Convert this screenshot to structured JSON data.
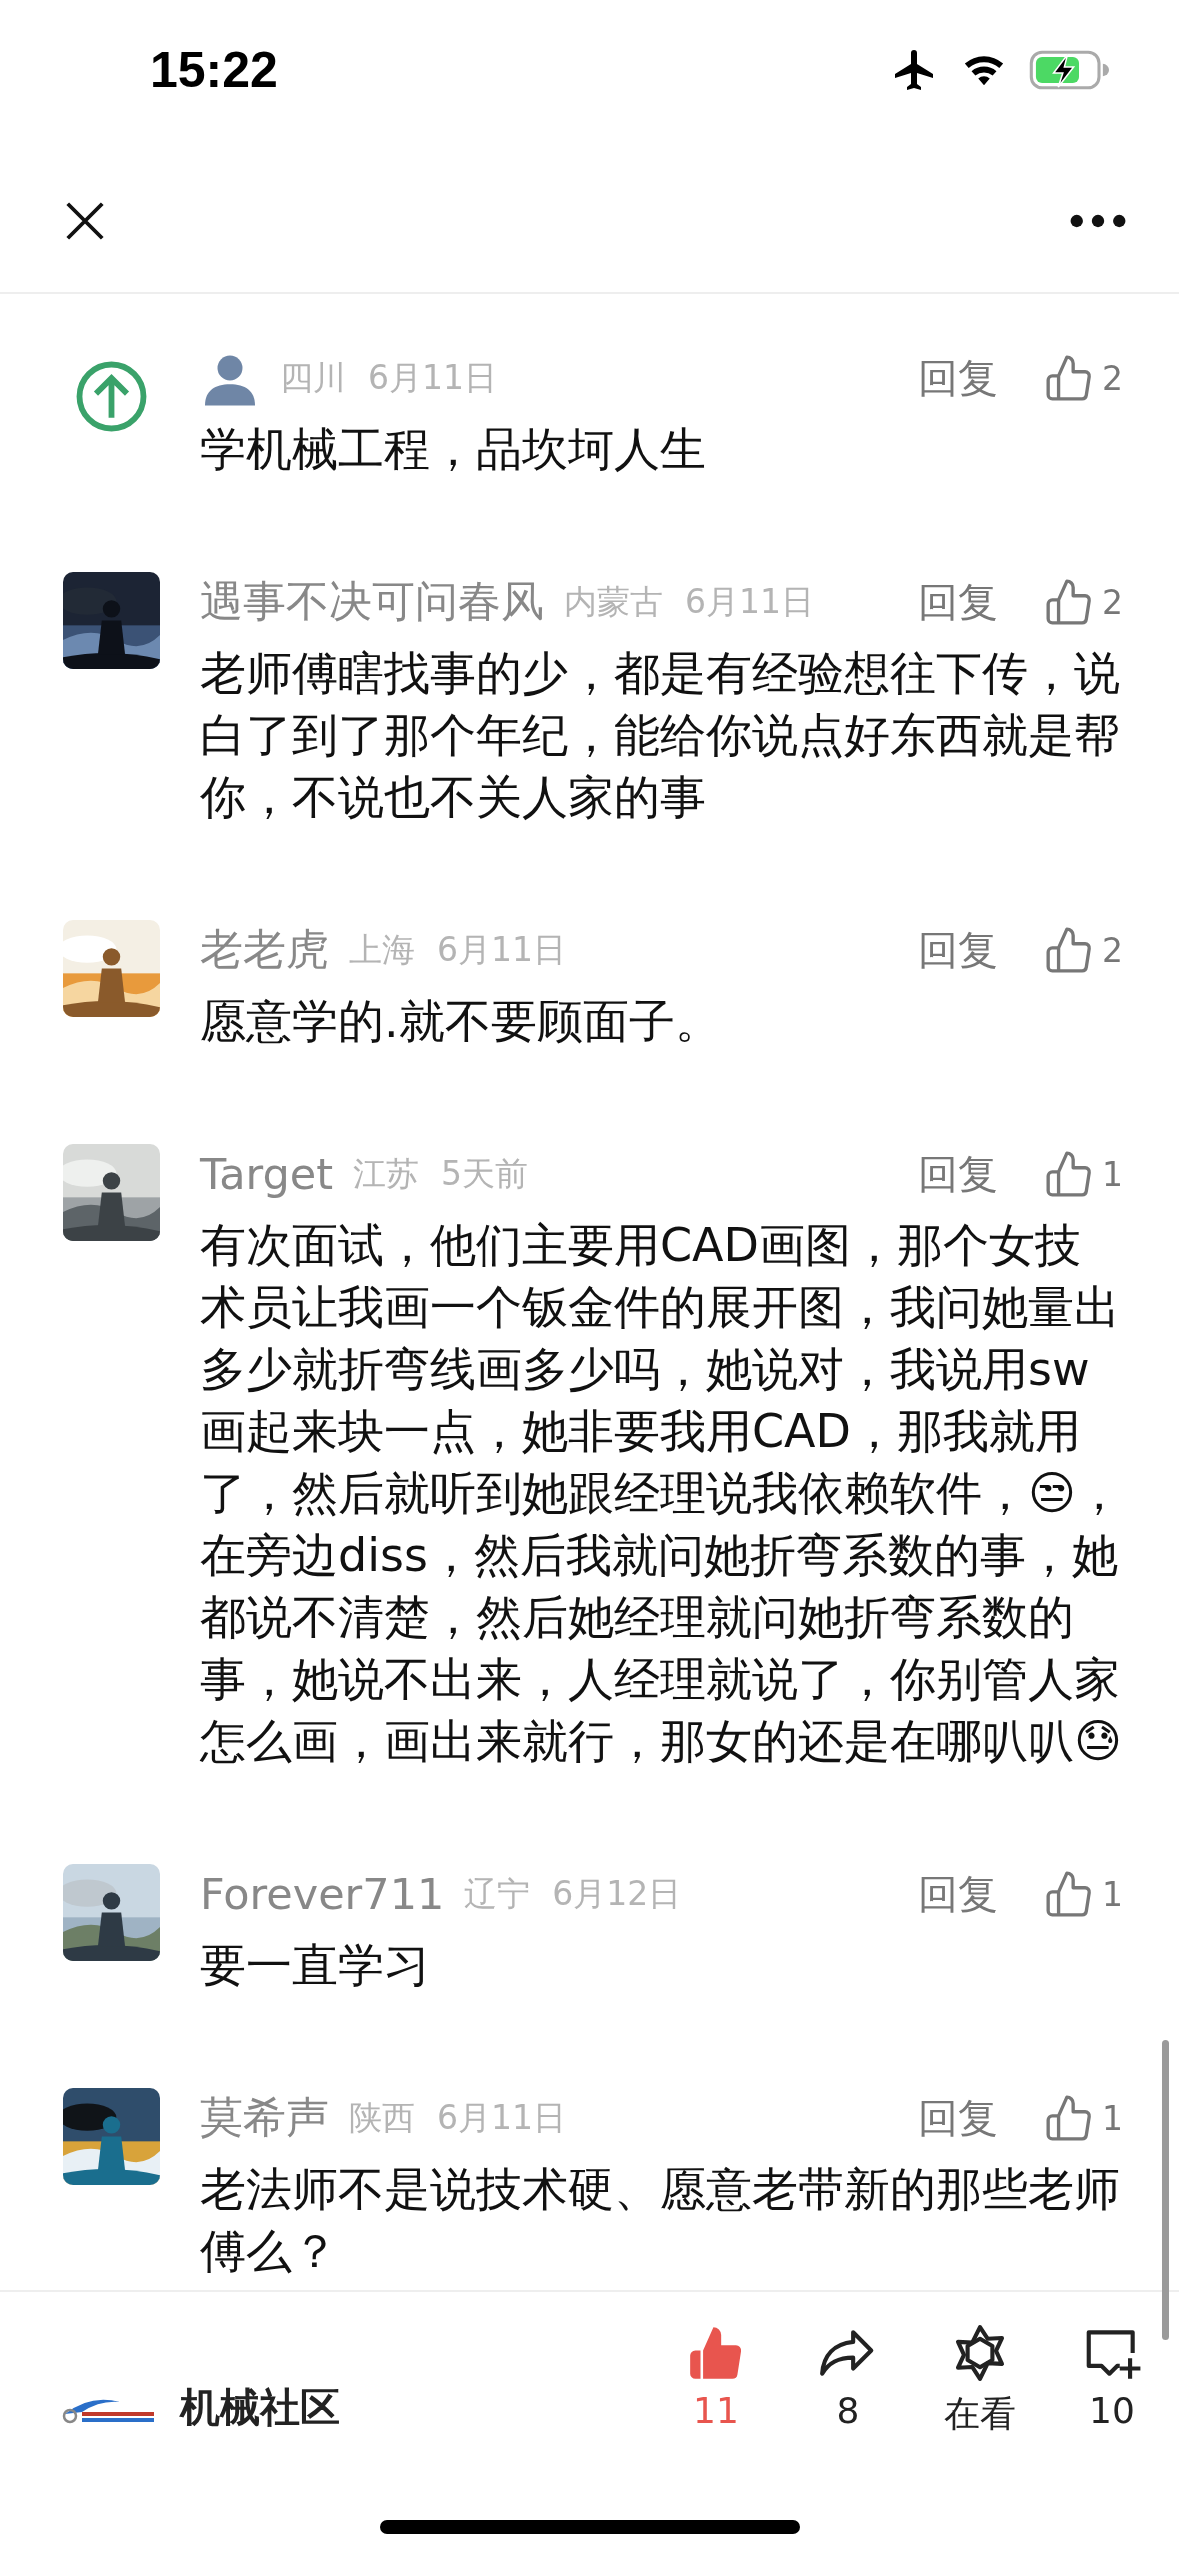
{
  "status_bar": {
    "time": "15:22"
  },
  "comments": [
    {
      "kind": "official",
      "region": "四川",
      "date": "6月11日",
      "reply": "回复",
      "likes": "2",
      "body": "学机械工程，品坎坷人生"
    },
    {
      "kind": "user",
      "name": "遇事不决可问春风",
      "region": "内蒙古",
      "date": "6月11日",
      "reply": "回复",
      "likes": "2",
      "body": "老师傅瞎找事的少，都是有经验想往下传，说白了到了那个年纪，能给你说点好东西就是帮你，不说也不关人家的事"
    },
    {
      "kind": "user",
      "name": "老老虎",
      "region": "上海",
      "date": "6月11日",
      "reply": "回复",
      "likes": "2",
      "body": "愿意学的.就不要顾面子。"
    },
    {
      "kind": "user",
      "name": "Target",
      "region": "江苏",
      "date": "5天前",
      "reply": "回复",
      "likes": "1",
      "body": "有次面试，他们主要用CAD画图，那个女技术员让我画一个钣金件的展开图，我问她量出多少就折弯线画多少吗，她说对，我说用sw画起来块一点，她非要我用CAD，那我就用了，然后就听到她跟经理说我依赖软件，😒，在旁边diss，然后我就问她折弯系数的事，她都说不清楚，然后她经理就问她折弯系数的事，她说不出来，人经理就说了，你别管人家怎么画，画出来就行，那女的还是在哪叭叭😓"
    },
    {
      "kind": "user",
      "name": "Forever711",
      "region": "辽宁",
      "date": "6月12日",
      "reply": "回复",
      "likes": "1",
      "body": "要一直学习"
    },
    {
      "kind": "user",
      "name": "莫希声",
      "region": "陕西",
      "date": "6月11日",
      "reply": "回复",
      "likes": "1",
      "body": "老法师不是说技术硬、愿意老带新的那些老师傅么？"
    }
  ],
  "bottom_bar": {
    "account": "机械社区",
    "actions": [
      {
        "kind": "like",
        "count": "11",
        "on": true
      },
      {
        "kind": "share",
        "count": "8",
        "on": false
      },
      {
        "kind": "watch",
        "count": "在看",
        "on": false
      },
      {
        "kind": "comment",
        "count": "10",
        "on": false
      }
    ]
  }
}
